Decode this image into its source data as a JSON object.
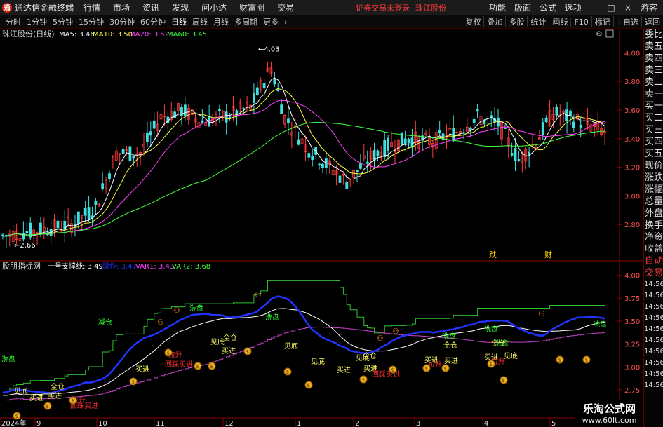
{
  "menubar": {
    "app_title": "通达信金融终端",
    "items": [
      "行情",
      "市场",
      "资讯",
      "发现",
      "问小达",
      "财富圈",
      "交易"
    ],
    "alert": "证券交易未登录",
    "stock_name": "珠江股份",
    "right_items": [
      "功能",
      "版面",
      "公式",
      "选项"
    ],
    "user": "游客"
  },
  "toolbar": {
    "periods": [
      "分时",
      "1分钟",
      "5分钟",
      "15分钟",
      "30分钟",
      "60分钟",
      "日线",
      "周线",
      "月线",
      "多周期",
      "更多"
    ],
    "active_period": "日线",
    "buttons": [
      "复权",
      "叠加",
      "多股",
      "统计",
      "画线",
      "F10",
      "标记",
      "+自选",
      "返回"
    ]
  },
  "main_chart": {
    "title": "珠江股份(日线)",
    "ma5": "MA5: 3.46",
    "ma10": "MA10: 3.50",
    "ma20": "MA20: 3.52",
    "ma60": "MA60: 3.45",
    "high_label": "4.03",
    "low_label": "2.66",
    "y_ticks": [
      "4.00",
      "3.80",
      "3.60",
      "3.40",
      "3.20",
      "3.00",
      "2.80"
    ],
    "markers": [
      "跌",
      "财"
    ]
  },
  "indicator": {
    "title": "股朋指标网",
    "line1": "一号支撑线: 3.49",
    "line2": "操作: 3.47",
    "var1": "VAR1: 3.43",
    "var2": "VAR2: 3.68",
    "y_ticks": [
      "4.00",
      "3.75",
      "3.50",
      "3.25",
      "3.00",
      "2.75"
    ],
    "annotations": {
      "wash": "洗盘",
      "cut": "减仓",
      "see_bottom": "见底",
      "buy": "买进",
      "full": "全仓",
      "rise": "拉升",
      "back_buy": "回踩买进"
    }
  },
  "x_axis": [
    "2024年",
    "9",
    "10",
    "11",
    "12",
    "1",
    "2",
    "3",
    "4",
    "5"
  ],
  "side_panel": [
    "委比",
    "卖五",
    "卖四",
    "卖三",
    "卖二",
    "卖一",
    "买一",
    "买二",
    "买三",
    "买四",
    "买五",
    "现价",
    "涨跌",
    "涨幅",
    "总量",
    "外盘",
    "换手",
    "净资",
    "收益",
    "自动",
    "交易",
    "14:56",
    "14:56",
    "14:56",
    "14:56",
    "14:56",
    "14:56",
    "14:56",
    "14:56",
    "14:56",
    "14:56"
  ],
  "watermark": {
    "line1": "乐淘公式网",
    "line2": "www.60lt.com"
  },
  "colors": {
    "up": "#ff3c3c",
    "down": "#40e0e0",
    "ma5": "#ffffff",
    "ma10": "#ffff40",
    "ma20": "#ff40ff",
    "ma60": "#40ff40",
    "blue_line": "#2233ff",
    "green_line": "#30c030",
    "purple_line": "#c040c0"
  }
}
